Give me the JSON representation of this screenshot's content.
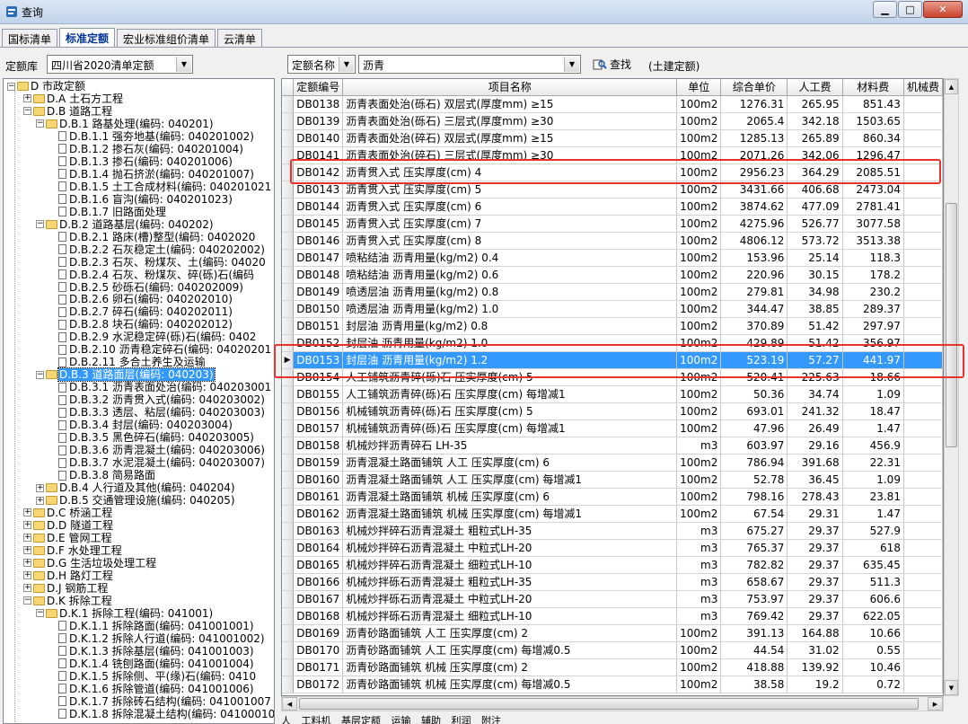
{
  "window": {
    "title": "查询",
    "controls": {
      "min": "▁",
      "max": "□",
      "close": "✕"
    }
  },
  "tabs": [
    "国标清单",
    "标准定额",
    "宏业标准组价清单",
    "云清单"
  ],
  "toolbar": {
    "library_label": "定额库",
    "library_value": "四川省2020清单定额",
    "field_value": "定额名称",
    "search_value": "沥青",
    "search_button": "查找",
    "category": "(土建定额)"
  },
  "tree": {
    "root": "D 市政定额",
    "nodes": [
      {
        "text": "D.A 土石方工程",
        "level": 1,
        "exp": "+",
        "icon": "folder"
      },
      {
        "text": "D.B 道路工程",
        "level": 1,
        "exp": "-",
        "icon": "folder"
      },
      {
        "text": "D.B.1 路基处理(编码: 040201)",
        "level": 2,
        "exp": "-",
        "icon": "folder"
      },
      {
        "text": "D.B.1.1 强夯地基(编码: 040201002)",
        "level": 3,
        "icon": "doc"
      },
      {
        "text": "D.B.1.2 掺石灰(编码: 040201004)",
        "level": 3,
        "icon": "doc"
      },
      {
        "text": "D.B.1.3 掺石(编码: 040201006)",
        "level": 3,
        "icon": "doc"
      },
      {
        "text": "D.B.1.4 抛石挤淤(编码: 040201007)",
        "level": 3,
        "icon": "doc"
      },
      {
        "text": "D.B.1.5 土工合成材料(编码: 040201021",
        "level": 3,
        "icon": "doc"
      },
      {
        "text": "D.B.1.6 盲沟(编码: 040201023)",
        "level": 3,
        "icon": "doc"
      },
      {
        "text": "D.B.1.7 旧路面处理",
        "level": 3,
        "icon": "doc"
      },
      {
        "text": "D.B.2 道路基层(编码: 040202)",
        "level": 2,
        "exp": "-",
        "icon": "folder"
      },
      {
        "text": "D.B.2.1 路床(槽)整型(编码: 0402020",
        "level": 3,
        "icon": "doc"
      },
      {
        "text": "D.B.2.2 石灰稳定土(编码: 040202002)",
        "level": 3,
        "icon": "doc"
      },
      {
        "text": "D.B.2.3 石灰、粉煤灰、土(编码: 04020",
        "level": 3,
        "icon": "doc"
      },
      {
        "text": "D.B.2.4 石灰、粉煤灰、碎(砾)石(编码",
        "level": 3,
        "icon": "doc"
      },
      {
        "text": "D.B.2.5 砂砾石(编码: 040202009)",
        "level": 3,
        "icon": "doc"
      },
      {
        "text": "D.B.2.6 卵石(编码: 040202010)",
        "level": 3,
        "icon": "doc"
      },
      {
        "text": "D.B.2.7 碎石(编码: 040202011)",
        "level": 3,
        "icon": "doc"
      },
      {
        "text": "D.B.2.8 块石(编码: 040202012)",
        "level": 3,
        "icon": "doc"
      },
      {
        "text": "D.B.2.9 水泥稳定碎(砾)石(编码: 0402",
        "level": 3,
        "icon": "doc"
      },
      {
        "text": "D.B.2.10 沥青稳定碎石(编码: 04020201",
        "level": 3,
        "icon": "doc"
      },
      {
        "text": "D.B.2.11 多合土养生及运输",
        "level": 3,
        "icon": "doc"
      },
      {
        "text": "D.B.3 道路面层(编码: 040203)",
        "level": 2,
        "exp": "-",
        "icon": "folder",
        "selected": true
      },
      {
        "text": "D.B.3.1 沥青表面处治(编码: 040203001",
        "level": 3,
        "icon": "doc"
      },
      {
        "text": "D.B.3.2 沥青贯入式(编码: 040203002)",
        "level": 3,
        "icon": "doc"
      },
      {
        "text": "D.B.3.3 透层、粘层(编码: 040203003)",
        "level": 3,
        "icon": "doc"
      },
      {
        "text": "D.B.3.4 封层(编码: 040203004)",
        "level": 3,
        "icon": "doc"
      },
      {
        "text": "D.B.3.5 黑色碎石(编码: 040203005)",
        "level": 3,
        "icon": "doc"
      },
      {
        "text": "D.B.3.6 沥青混凝土(编码: 040203006)",
        "level": 3,
        "icon": "doc"
      },
      {
        "text": "D.B.3.7 水泥混凝土(编码: 040203007)",
        "level": 3,
        "icon": "doc"
      },
      {
        "text": "D.B.3.8 简易路面",
        "level": 3,
        "icon": "doc"
      },
      {
        "text": "D.B.4 人行道及其他(编码: 040204)",
        "level": 2,
        "exp": "+",
        "icon": "folder"
      },
      {
        "text": "D.B.5 交通管理设施(编码: 040205)",
        "level": 2,
        "exp": "+",
        "icon": "folder"
      },
      {
        "text": "D.C 桥涵工程",
        "level": 1,
        "exp": "+",
        "icon": "folder"
      },
      {
        "text": "D.D 隧道工程",
        "level": 1,
        "exp": "+",
        "icon": "folder"
      },
      {
        "text": "D.E 管网工程",
        "level": 1,
        "exp": "+",
        "icon": "folder"
      },
      {
        "text": "D.F 水处理工程",
        "level": 1,
        "exp": "+",
        "icon": "folder"
      },
      {
        "text": "D.G 生活垃圾处理工程",
        "level": 1,
        "exp": "+",
        "icon": "folder"
      },
      {
        "text": "D.H 路灯工程",
        "level": 1,
        "exp": "+",
        "icon": "folder"
      },
      {
        "text": "D.J 钢筋工程",
        "level": 1,
        "exp": "+",
        "icon": "folder"
      },
      {
        "text": "D.K 拆除工程",
        "level": 1,
        "exp": "-",
        "icon": "folder"
      },
      {
        "text": "D.K.1 拆除工程(编码: 041001)",
        "level": 2,
        "exp": "-",
        "icon": "folder"
      },
      {
        "text": "D.K.1.1 拆除路面(编码: 041001001)",
        "level": 3,
        "icon": "doc"
      },
      {
        "text": "D.K.1.2 拆除人行道(编码: 041001002)",
        "level": 3,
        "icon": "doc"
      },
      {
        "text": "D.K.1.3 拆除基层(编码: 041001003)",
        "level": 3,
        "icon": "doc"
      },
      {
        "text": "D.K.1.4 铣刨路面(编码: 041001004)",
        "level": 3,
        "icon": "doc"
      },
      {
        "text": "D.K.1.5 拆除侧、平(缘)石(编码: 0410",
        "level": 3,
        "icon": "doc"
      },
      {
        "text": "D.K.1.6 拆除管道(编码: 041001006)",
        "level": 3,
        "icon": "doc"
      },
      {
        "text": "D.K.1.7 拆除砖石结构(编码: 041001007",
        "level": 3,
        "icon": "doc"
      },
      {
        "text": "D.K.1.8 拆除混凝土结构(编码: 04100010",
        "level": 3,
        "icon": "doc"
      }
    ]
  },
  "grid": {
    "columns": [
      "定额编号",
      "项目名称",
      "单位",
      "综合单价",
      "人工费",
      "材料费",
      "机械费"
    ],
    "rows": [
      [
        "DB0138",
        "沥青表面处治(砾石) 双层式(厚度mm) ≥15",
        "100m2",
        "1276.31",
        "265.95",
        "851.43"
      ],
      [
        "DB0139",
        "沥青表面处治(砾石) 三层式(厚度mm) ≥30",
        "100m2",
        "2065.4",
        "342.18",
        "1503.65"
      ],
      [
        "DB0140",
        "沥青表面处治(碎石) 双层式(厚度mm) ≥15",
        "100m2",
        "1285.13",
        "265.89",
        "860.34"
      ],
      [
        "DB0141",
        "沥青表面处治(碎石) 三层式(厚度mm) ≥30",
        "100m2",
        "2071.26",
        "342.06",
        "1296.47"
      ],
      [
        "DB0142",
        "沥青贯入式 压实厚度(cm) 4",
        "100m2",
        "2956.23",
        "364.29",
        "2085.51"
      ],
      [
        "DB0143",
        "沥青贯入式 压实厚度(cm) 5",
        "100m2",
        "3431.66",
        "406.68",
        "2473.04"
      ],
      [
        "DB0144",
        "沥青贯入式 压实厚度(cm) 6",
        "100m2",
        "3874.62",
        "477.09",
        "2781.41"
      ],
      [
        "DB0145",
        "沥青贯入式 压实厚度(cm) 7",
        "100m2",
        "4275.96",
        "526.77",
        "3077.58"
      ],
      [
        "DB0146",
        "沥青贯入式 压实厚度(cm) 8",
        "100m2",
        "4806.12",
        "573.72",
        "3513.38"
      ],
      [
        "DB0147",
        "喷粘结油 沥青用量(kg/m2) 0.4",
        "100m2",
        "153.96",
        "25.14",
        "118.3"
      ],
      [
        "DB0148",
        "喷粘结油 沥青用量(kg/m2) 0.6",
        "100m2",
        "220.96",
        "30.15",
        "178.2"
      ],
      [
        "DB0149",
        "喷透层油 沥青用量(kg/m2) 0.8",
        "100m2",
        "279.81",
        "34.98",
        "230.2"
      ],
      [
        "DB0150",
        "喷透层油 沥青用量(kg/m2) 1.0",
        "100m2",
        "344.47",
        "38.85",
        "289.37"
      ],
      [
        "DB0151",
        "封层油 沥青用量(kg/m2) 0.8",
        "100m2",
        "370.89",
        "51.42",
        "297.97"
      ],
      [
        "DB0152",
        "封层油 沥青用量(kg/m2) 1.0",
        "100m2",
        "429.89",
        "51.42",
        "356.97"
      ],
      [
        "DB0153",
        "封层油 沥青用量(kg/m2) 1.2",
        "100m2",
        "523.19",
        "57.27",
        "441.97"
      ],
      [
        "DB0154",
        "人工铺筑沥青碎(砾)石 压实厚度(cm) 5",
        "100m2",
        "520.41",
        "225.63",
        "18.66"
      ],
      [
        "DB0155",
        "人工铺筑沥青碎(砾)石 压实厚度(cm) 每增减1",
        "100m2",
        "50.36",
        "34.74",
        "1.09"
      ],
      [
        "DB0156",
        "机械铺筑沥青碎(砾)石 压实厚度(cm) 5",
        "100m2",
        "693.01",
        "241.32",
        "18.47"
      ],
      [
        "DB0157",
        "机械铺筑沥青碎(砾)石 压实厚度(cm) 每增减1",
        "100m2",
        "47.96",
        "26.49",
        "1.47"
      ],
      [
        "DB0158",
        "机械炒拌沥青碎石 LH-35",
        "m3",
        "603.97",
        "29.16",
        "456.9"
      ],
      [
        "DB0159",
        "沥青混凝土路面铺筑 人工 压实厚度(cm) 6",
        "100m2",
        "786.94",
        "391.68",
        "22.31"
      ],
      [
        "DB0160",
        "沥青混凝土路面铺筑 人工 压实厚度(cm) 每增减1",
        "100m2",
        "52.78",
        "36.45",
        "1.09"
      ],
      [
        "DB0161",
        "沥青混凝土路面铺筑 机械 压实厚度(cm) 6",
        "100m2",
        "798.16",
        "278.43",
        "23.81"
      ],
      [
        "DB0162",
        "沥青混凝土路面铺筑 机械 压实厚度(cm) 每增减1",
        "100m2",
        "67.54",
        "29.31",
        "1.47"
      ],
      [
        "DB0163",
        "机械炒拌碎石沥青混凝土 粗粒式LH-35",
        "m3",
        "675.27",
        "29.37",
        "527.9"
      ],
      [
        "DB0164",
        "机械炒拌碎石沥青混凝土 中粒式LH-20",
        "m3",
        "765.37",
        "29.37",
        "618"
      ],
      [
        "DB0165",
        "机械炒拌碎石沥青混凝土 细粒式LH-10",
        "m3",
        "782.82",
        "29.37",
        "635.45"
      ],
      [
        "DB0166",
        "机械炒拌砾石沥青混凝土 粗粒式LH-35",
        "m3",
        "658.67",
        "29.37",
        "511.3"
      ],
      [
        "DB0167",
        "机械炒拌砾石沥青混凝土 中粒式LH-20",
        "m3",
        "753.97",
        "29.37",
        "606.6"
      ],
      [
        "DB0168",
        "机械炒拌砾石沥青混凝土 细粒式LH-10",
        "m3",
        "769.42",
        "29.37",
        "622.05"
      ],
      [
        "DB0169",
        "沥青砂路面铺筑 人工 压实厚度(cm) 2",
        "100m2",
        "391.13",
        "164.88",
        "10.66"
      ],
      [
        "DB0170",
        "沥青砂路面铺筑 人工 压实厚度(cm) 每增减0.5",
        "100m2",
        "44.54",
        "31.02",
        "0.55"
      ],
      [
        "DB0171",
        "沥青砂路面铺筑 机械 压实厚度(cm) 2",
        "100m2",
        "418.88",
        "139.92",
        "10.46"
      ],
      [
        "DB0172",
        "沥青砂路面铺筑 机械 压实厚度(cm) 每增减0.5",
        "100m2",
        "38.58",
        "19.2",
        "0.72"
      ]
    ],
    "selected_row": 15,
    "row_pointer": "▶"
  },
  "bottom_tabs": [
    "人",
    "工料机",
    "基层定额",
    "运输",
    "辅助",
    "利润",
    "附注"
  ],
  "colors": {
    "selection": "#3399ff",
    "highlight_box": "#e8322b",
    "title_bar": "#c2d4ea"
  }
}
